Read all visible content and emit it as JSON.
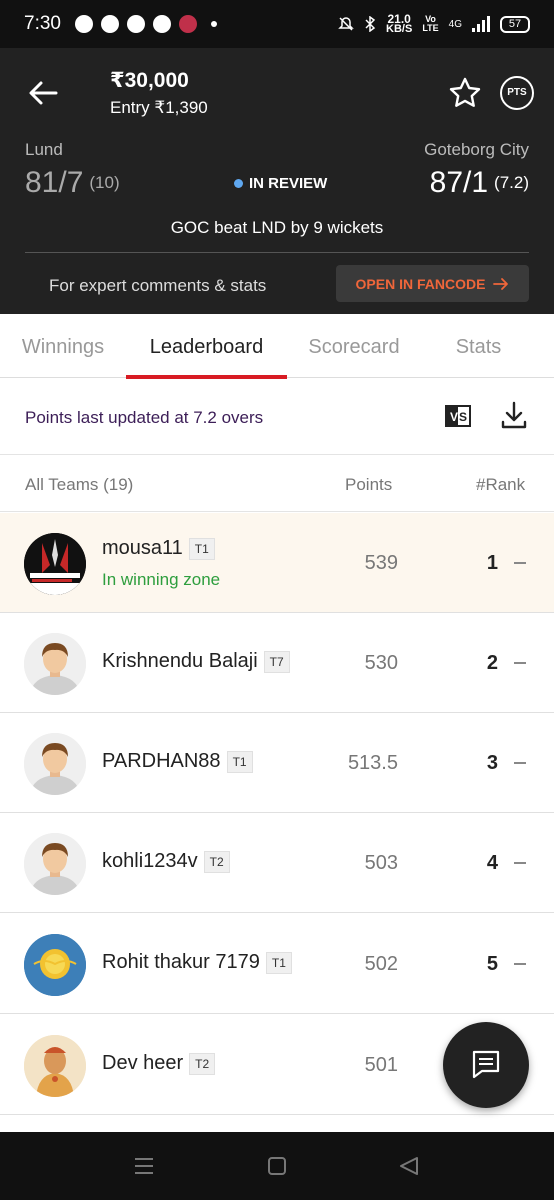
{
  "status_bar": {
    "time": "7:30",
    "speed_value": "21.0",
    "speed_unit": "KB/S",
    "volte_top": "Vo",
    "volte_bottom": "LTE",
    "network": "4G",
    "battery": "57"
  },
  "header": {
    "prize": "₹30,000",
    "entry": "Entry ₹1,390",
    "pts_label": "PTS",
    "team1": {
      "name": "Lund",
      "score": "81/7",
      "overs": "(10)"
    },
    "team2": {
      "name": "Goteborg City",
      "score": "87/1",
      "overs": "(7.2)"
    },
    "status": "IN REVIEW",
    "status_color": "#5fa8f0",
    "result": "GOC beat LND by 9 wickets",
    "expert_text": "For expert comments & stats",
    "fancode_button": "OPEN IN FANCODE",
    "fancode_color": "#f0663a"
  },
  "tabs": [
    {
      "label": "Winnings",
      "active": false
    },
    {
      "label": "Leaderboard",
      "active": true
    },
    {
      "label": "Scorecard",
      "active": false
    },
    {
      "label": "Stats",
      "active": false
    }
  ],
  "info": {
    "text": "Points last updated at 7.2 overs",
    "compare_icon": "vs-compare-icon",
    "download_icon": "download-icon"
  },
  "table": {
    "col_teams": "All Teams (19)",
    "col_points": "Points",
    "col_rank": "#Rank",
    "rows": [
      {
        "name": "mousa11",
        "team": "T1",
        "points": "539",
        "rank": "1",
        "zone": "In winning zone",
        "avatar": "conquerors-logo"
      },
      {
        "name": "Krishnendu Balaji",
        "team": "T7",
        "points": "530",
        "rank": "2",
        "avatar": "default-avatar"
      },
      {
        "name": "PARDHAN88",
        "team": "T1",
        "points": "513.5",
        "rank": "3",
        "avatar": "default-avatar"
      },
      {
        "name": "kohli1234v",
        "team": "T2",
        "points": "503",
        "rank": "4",
        "avatar": "default-avatar"
      },
      {
        "name": "Rohit thakur 7179",
        "team": "T1",
        "points": "502",
        "rank": "5",
        "avatar": "sun-avatar"
      },
      {
        "name": "Dev heer",
        "team": "T2",
        "points": "501",
        "rank": "",
        "avatar": "deity-avatar"
      }
    ]
  },
  "accent_color": "#d81b23"
}
